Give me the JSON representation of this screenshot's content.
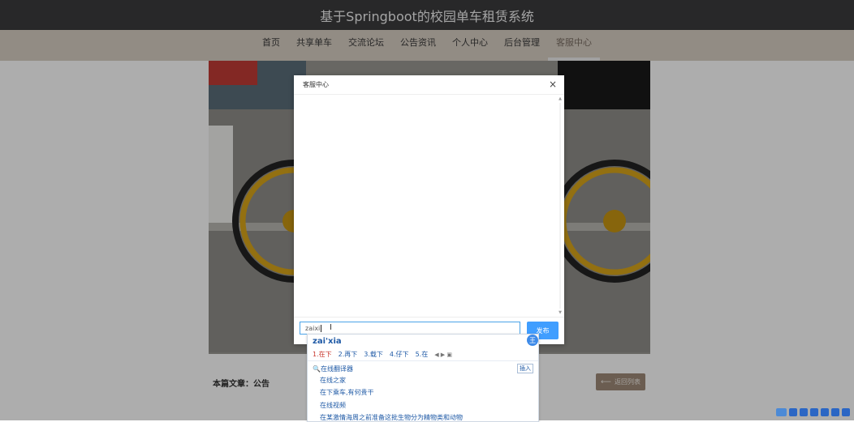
{
  "header": {
    "title": "基于Springboot的校园单车租赁系统"
  },
  "nav": {
    "items": [
      {
        "label": "首页"
      },
      {
        "label": "共享单车"
      },
      {
        "label": "交流论坛"
      },
      {
        "label": "公告资讯"
      },
      {
        "label": "个人中心"
      },
      {
        "label": "后台管理"
      },
      {
        "label": "客服中心"
      }
    ],
    "active_index": 6
  },
  "article": {
    "meta_label": "本篇文章：公告",
    "back_label": "返回列表",
    "back_icon": "arrow-left-icon"
  },
  "dialog": {
    "title": "客服中心",
    "close_glyph": "×",
    "input_value": "zaixi",
    "send_label": "发布"
  },
  "ime": {
    "composition": "zai'xia",
    "badge": "王",
    "candidates": [
      "1.在下",
      "2.再下",
      "3.载下",
      "4.仔下",
      "5.在"
    ],
    "pager": "◀ ▶ ▣",
    "translator": "在线翻译器",
    "insert_label": "插入",
    "suggestions": [
      "在线之家",
      "在下乘车,有何贵干",
      "在线视频",
      "在某激情海周之前准备这批生物分为精物类和动物"
    ]
  },
  "colors": {
    "titlebar": "#3b3b3d",
    "nav": "#d8cec3",
    "send": "#409eff",
    "back": "#9e8a78"
  }
}
